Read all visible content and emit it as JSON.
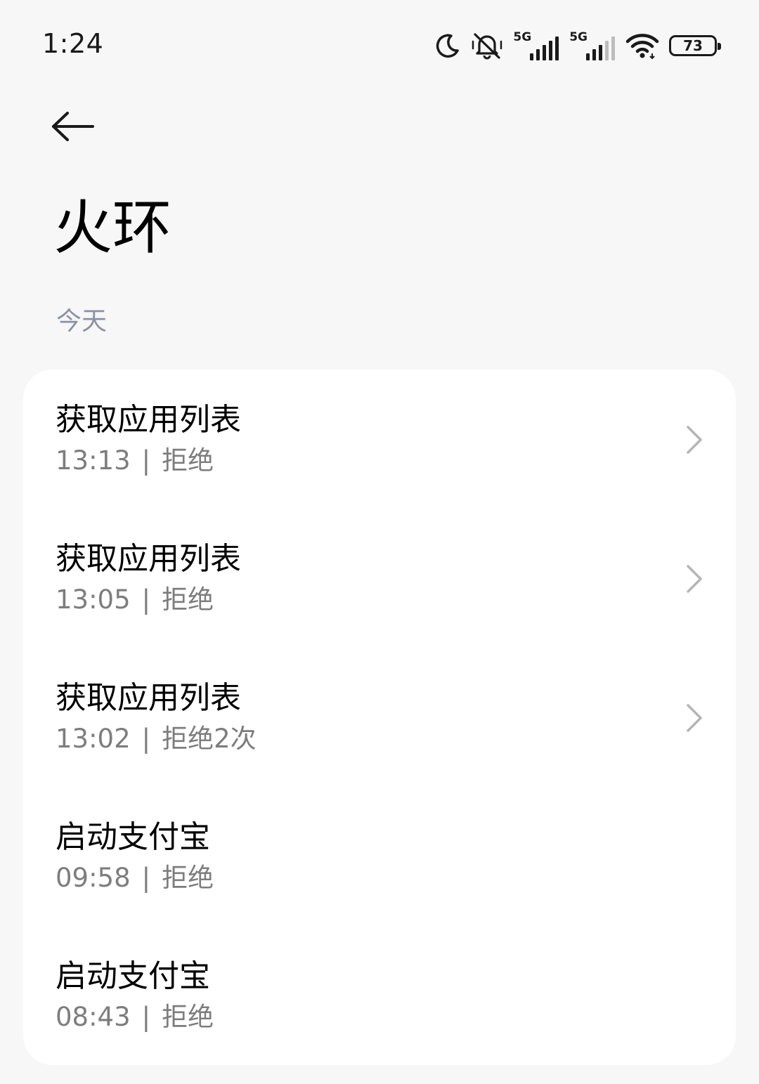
{
  "status_bar": {
    "time": "1:24",
    "network_1": "5G",
    "network_2": "5G",
    "battery": "73",
    "icons": [
      "moon-icon",
      "mute-icon",
      "signal-icon",
      "signal-icon",
      "wifi-icon",
      "battery-icon"
    ]
  },
  "header": {
    "back_icon": "back-arrow-icon",
    "title": "火环"
  },
  "section": {
    "label": "今天"
  },
  "records": [
    {
      "title": "获取应用列表",
      "time": "13:13",
      "separator": "|",
      "result": "拒绝",
      "has_chevron": true
    },
    {
      "title": "获取应用列表",
      "time": "13:05",
      "separator": "|",
      "result": "拒绝",
      "has_chevron": true
    },
    {
      "title": "获取应用列表",
      "time": "13:02",
      "separator": "|",
      "result": "拒绝2次",
      "has_chevron": true
    },
    {
      "title": "启动支付宝",
      "time": "09:58",
      "separator": "|",
      "result": "拒绝",
      "has_chevron": false
    },
    {
      "title": "启动支付宝",
      "time": "08:43",
      "separator": "|",
      "result": "拒绝",
      "has_chevron": false
    }
  ],
  "colors": {
    "background": "#f7f7f7",
    "card": "#ffffff",
    "section_label": "#8a92a6",
    "secondary_text": "#7d7d7d",
    "chevron": "#b5b5b5"
  }
}
